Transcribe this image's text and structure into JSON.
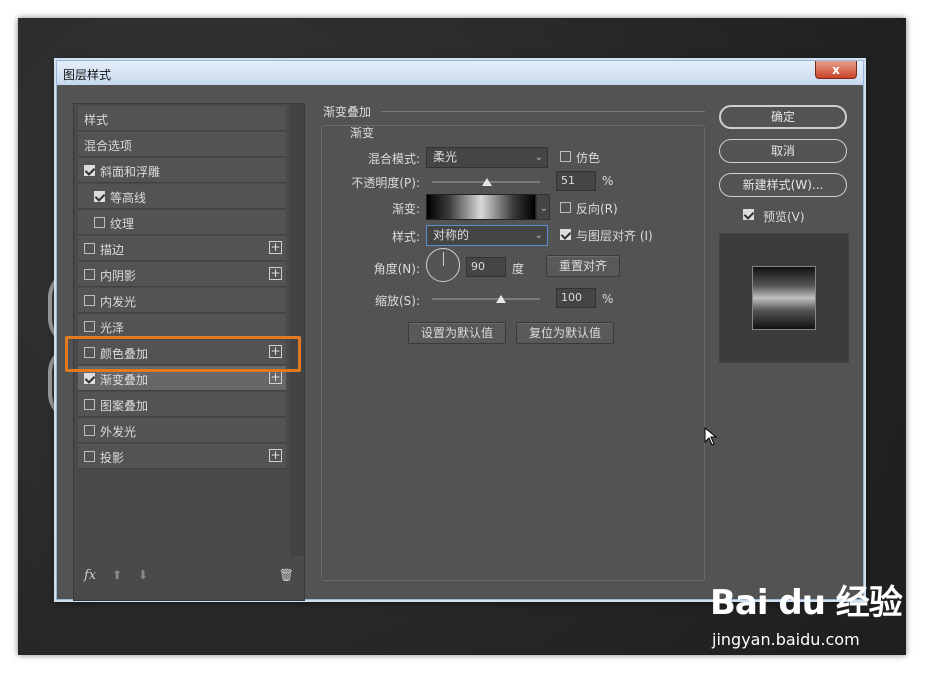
{
  "dialog": {
    "title": "图层样式",
    "close_label": "x"
  },
  "sidebar": {
    "items": [
      {
        "label": "样式",
        "checkbox": false,
        "checked": false,
        "plus": false,
        "indent": 0
      },
      {
        "label": "混合选项",
        "checkbox": false,
        "checked": false,
        "plus": false,
        "indent": 0
      },
      {
        "label": "斜面和浮雕",
        "checkbox": true,
        "checked": true,
        "plus": false,
        "indent": 0
      },
      {
        "label": "等高线",
        "checkbox": true,
        "checked": true,
        "plus": false,
        "indent": 1
      },
      {
        "label": "纹理",
        "checkbox": true,
        "checked": false,
        "plus": false,
        "indent": 1
      },
      {
        "label": "描边",
        "checkbox": true,
        "checked": false,
        "plus": true,
        "indent": 0
      },
      {
        "label": "内阴影",
        "checkbox": true,
        "checked": false,
        "plus": true,
        "indent": 0
      },
      {
        "label": "内发光",
        "checkbox": true,
        "checked": false,
        "plus": false,
        "indent": 0
      },
      {
        "label": "光泽",
        "checkbox": true,
        "checked": false,
        "plus": false,
        "indent": 0
      },
      {
        "label": "颜色叠加",
        "checkbox": true,
        "checked": false,
        "plus": true,
        "indent": 0
      },
      {
        "label": "渐变叠加",
        "checkbox": true,
        "checked": true,
        "plus": true,
        "indent": 0,
        "active": true
      },
      {
        "label": "图案叠加",
        "checkbox": true,
        "checked": false,
        "plus": false,
        "indent": 0
      },
      {
        "label": "外发光",
        "checkbox": true,
        "checked": false,
        "plus": false,
        "indent": 0
      },
      {
        "label": "投影",
        "checkbox": true,
        "checked": false,
        "plus": true,
        "indent": 0
      }
    ],
    "footer": {
      "fx": "fx",
      "up": "⬆",
      "down": "⬇",
      "trash": "🗑"
    }
  },
  "panel": {
    "section_title": "渐变叠加",
    "group_title": "渐变",
    "blend_mode_label": "混合模式:",
    "blend_mode_value": "柔光",
    "dither_label": "仿色",
    "opacity_label": "不透明度(P):",
    "opacity_value": "51",
    "opacity_percent": 51,
    "percent_unit": "%",
    "gradient_label": "渐变:",
    "reverse_label": "反向(R)",
    "style_label": "样式:",
    "style_value": "对称的",
    "align_label": "与图层对齐 (I)",
    "angle_label": "角度(N):",
    "angle_value": "90",
    "degree_unit": "度",
    "reset_align_label": "重置对齐",
    "scale_label": "缩放(S):",
    "scale_value": "100",
    "scale_percent": 100,
    "set_default_label": "设置为默认值",
    "reset_default_label": "复位为默认值"
  },
  "right": {
    "ok_label": "确定",
    "cancel_label": "取消",
    "new_style_label": "新建样式(W)...",
    "preview_label": "预览(V)",
    "preview_checked": true
  },
  "watermark": {
    "logo": "Bai du 经验",
    "url": "jingyan.baidu.com"
  }
}
